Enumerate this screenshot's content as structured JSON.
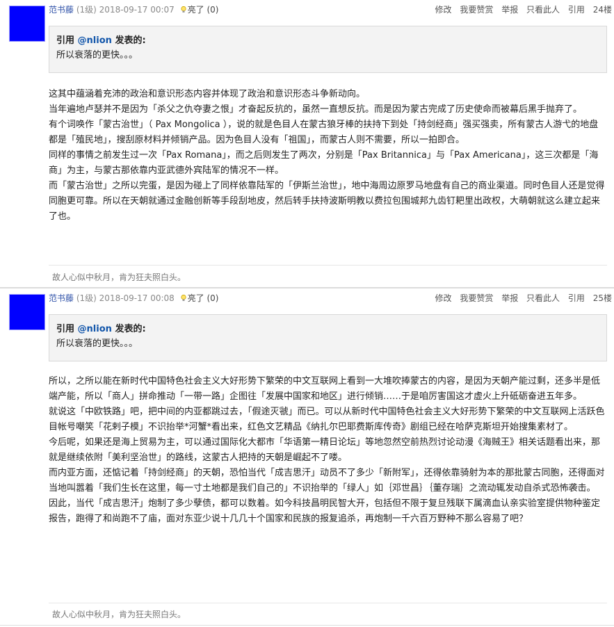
{
  "posts": [
    {
      "author": "范书藤",
      "level": "(1级)",
      "date": "2018-09-17 00:07",
      "liked_label": "亮了",
      "liked_count": "(0)",
      "actions": [
        "修改",
        "我要赞赏",
        "举报",
        "只看此人",
        "引用"
      ],
      "floor": "24楼",
      "quote": {
        "prefix": "引用",
        "user": "@nlion",
        "suffix": "发表的:",
        "text": "所以衰落的更快。。。"
      },
      "paragraphs": [
        "这其中蕴涵着充沛的政治和意识形态内容并体现了政治和意识形态斗争新动向。",
        "当年遍地卢瑟并不是因为「杀父之仇夺妻之恨」才奋起反抗的，虽然一直想反抗。而是因为蒙古完成了历史使命而被幕后黑手抛弃了。",
        "有个词唤作「蒙古治世」（ Pax Mongolica ），说的就是色目人在蒙古狼牙棒的扶持下到处「持剑经商」强买强卖，所有蒙古人游弋的地盘都是「殖民地」，搜刮原材料并倾销产品。因为色目人没有「祖国」，而蒙古人则不需要，所以一拍即合。",
        "同样的事情之前发生过一次「Pax Romana」，而之后则发生了两次，分别是「Pax Britannica」与「Pax Americana」，这三次都是「海商」为主，与蒙古那依靠内亚武德外宾陆军的情况不一样。",
        "而「蒙古治世」之所以完蛋，是因为碰上了同样依靠陆军的「伊斯兰治世」，地中海周边原罗马地盘有自己的商业渠道。同时色目人还是觉得同胞更可靠。所以在天朝就通过金融创新等手段刮地皮，然后转手扶持波斯明教以费拉包围城邦九齿钉耙里出政权，大萌朝就这么建立起来了也。"
      ],
      "signature": "故人心似中秋月，肯为狂夫照白头。"
    },
    {
      "author": "范书藤",
      "level": "(1级)",
      "date": "2018-09-17 00:08",
      "liked_label": "亮了",
      "liked_count": "(0)",
      "actions": [
        "修改",
        "我要赞赏",
        "举报",
        "只看此人",
        "引用"
      ],
      "floor": "25楼",
      "quote": {
        "prefix": "引用",
        "user": "@nlion",
        "suffix": "发表的:",
        "text": "所以衰落的更快。。。"
      },
      "paragraphs": [
        "所以，之所以能在新时代中国特色社会主义大好形势下繁荣的中文互联网上看到一大堆吹捧蒙古的内容，是因为天朝产能过剩，还多半是低端产能，所以「商人」拼命推动「一带一路」企图往「发展中国家和地区」进行倾销……于是咱厉害国这才虚火上升砥砺奋进五年多。",
        "就说这「中欧铁路」吧，把中间的内亚都跳过去，「假途灭虢」而已。可以从新时代中国特色社会主义大好形势下繁荣的中文互联网上活跃色目帐号嘲笑「花剌子模」不识抬举*河蟹*看出来，红色文艺精品《纳扎尔巴耶费斯库传奇》剧组已经在哈萨克斯坦开始搜集素材了。",
        "今后呢，如果还是海上贸易为主，可以通过国际化大都市「华语第一精日论坛」等地忽然空前热烈讨论动漫《海贼王》相关话题看出来，那就是继续依附「美利坚治世」的路线，这蒙古人把持的天朝是崛起不了喽。",
        "而内亚方面，还惦记着「持剑经商」的天朝，恐怕当代「成吉思汗」动员不了多少「新附军」，还得依靠骑射为本的那批蒙古同胞，还得面对当地叫嚣着「我们生长在这里，每一寸土地都是我们自己的」不识抬举的「绿人」如｛邓世昌｝｛董存瑞｝之流动辄发动自杀式恐怖袭击。",
        "因此，当代「成吉思汗」炮制了多少孽债，都可以数着。如今科技昌明民智大开，包括但不限于复旦残联下属滴血认亲实验室提供物种鉴定报告，跑得了和尚跑不了庙，面对东亚少说十几几十个国家和民族的报复追杀，再炮制一千六百万野种不那么容易了吧？"
      ],
      "signature": "故人心似中秋月，肯为狂夫照白头。"
    }
  ]
}
